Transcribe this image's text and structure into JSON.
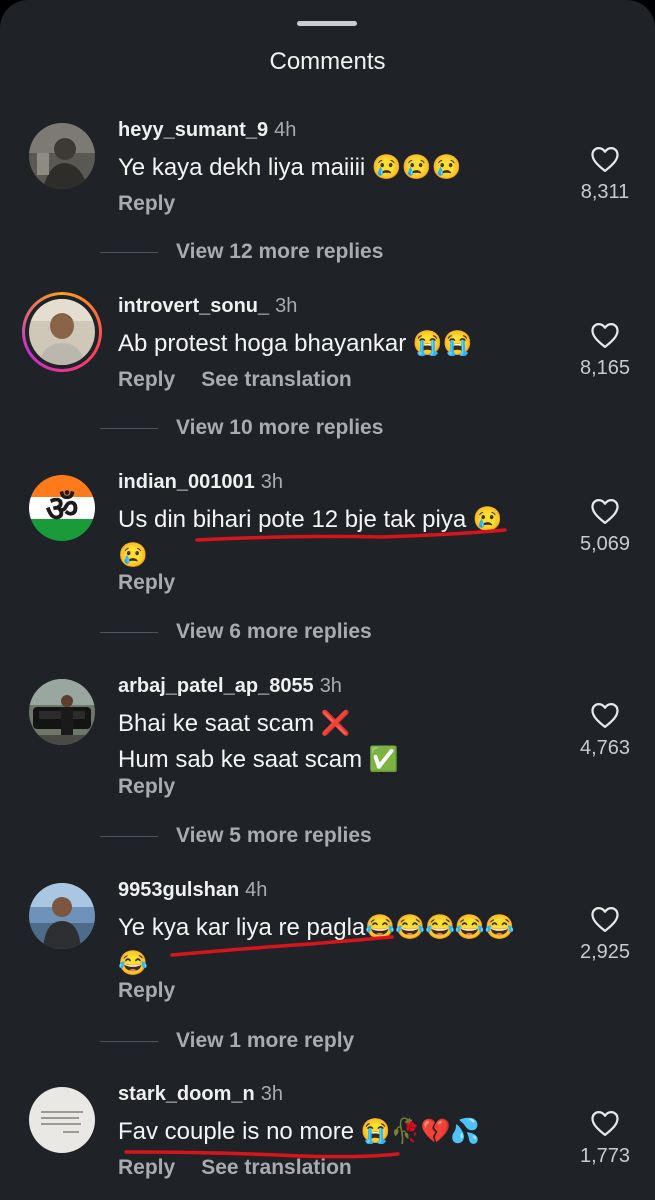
{
  "header": {
    "title": "Comments"
  },
  "comments": [
    {
      "username": "heyy_sumant_9",
      "time": "4h",
      "text": "Ye kaya dekh liya maiiii 😢😢😢",
      "reply": "Reply",
      "likes": "8,311",
      "replies": "View 12 more replies"
    },
    {
      "username": "introvert_sonu_",
      "time": "3h",
      "text": "Ab protest hoga bhayankar 😭😭",
      "reply": "Reply",
      "translate": "See translation",
      "likes": "8,165",
      "replies": "View 10 more replies"
    },
    {
      "username": "indian_001001",
      "time": "3h",
      "text": "Us din bihari pote 12 bje tak piya 😢\n😢",
      "reply": "Reply",
      "likes": "5,069",
      "replies": "View 6 more replies"
    },
    {
      "username": "arbaj_patel_ap_8055",
      "time": "3h",
      "text": "Bhai ke saat scam ❌\nHum sab ke saat scam ✅",
      "reply": "Reply",
      "likes": "4,763",
      "replies": "View 5 more replies"
    },
    {
      "username": "9953gulshan",
      "time": "4h",
      "text": "Ye kya kar liya re pagla😂😂😂😂😂\n😂",
      "reply": "Reply",
      "likes": "2,925",
      "replies": "View 1 more reply"
    },
    {
      "username": "stark_doom_n",
      "time": "3h",
      "text": "Fav couple is no more 😭🥀💔💦",
      "reply": "Reply",
      "translate": "See translation",
      "likes": "1,773"
    }
  ],
  "icons": {
    "like": "heart-outline-icon",
    "om": "ॐ"
  },
  "colors": {
    "background": "#1f2227",
    "annotation": "#d7141c"
  }
}
